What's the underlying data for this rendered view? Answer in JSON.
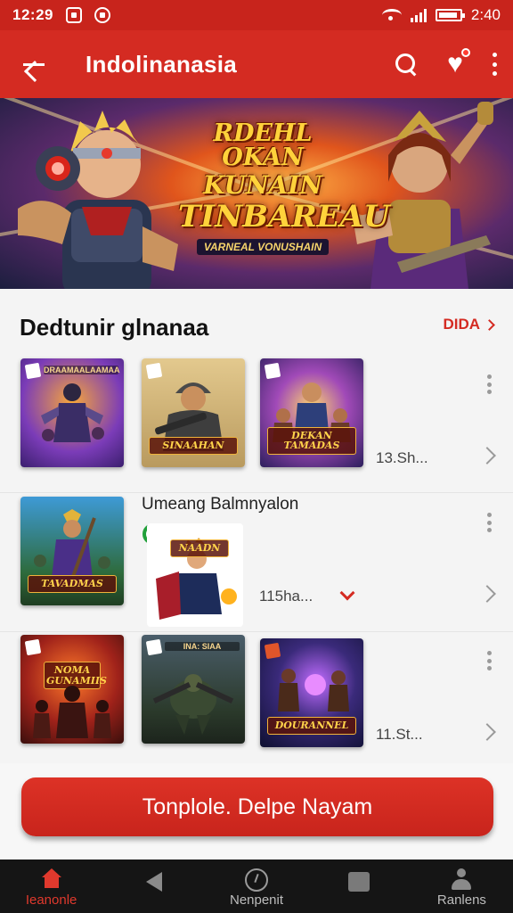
{
  "status_bar": {
    "time_left": "12:29",
    "time_right": "2:40"
  },
  "app_bar": {
    "title": "Indolinanasia",
    "icons": [
      "back-arrow-icon",
      "search-icon",
      "heart-icon",
      "more-vert-icon"
    ]
  },
  "banner": {
    "line1": "RDEHL OKAN",
    "line2": "KUNAIN",
    "line3": "TINBAREAU",
    "subtitle": "VARNEAL VONUSHAIN"
  },
  "section": {
    "title": "Dedtunir glnanaa",
    "see_all": "DIDA"
  },
  "rows": [
    {
      "count": "13.Sh...",
      "thumbs": [
        {
          "label": "",
          "top_label": "DRAAMAALAAMAA"
        },
        {
          "label": "SINAAHAN",
          "top_label": ""
        },
        {
          "label": "DEKAN TAMADAS",
          "top_label": ""
        }
      ]
    },
    {
      "title": "Umeang Balmnyalon",
      "count": "115ha...",
      "thumbs": [
        {
          "label": "TAVADMAS",
          "top_label": ""
        },
        {
          "label": "NAADN",
          "top_label": ""
        }
      ]
    },
    {
      "count": "11.St...",
      "thumbs": [
        {
          "label": "NOMA GUNAMIIS",
          "top_label": ""
        },
        {
          "label": "",
          "top_label": "INA: SIAA"
        },
        {
          "label": "DOURANNEL",
          "top_label": ""
        }
      ]
    }
  ],
  "cta": {
    "label": "Tonplole. Delpe Nayam"
  },
  "bottom_nav": {
    "items": [
      {
        "label": "Ieanonle",
        "icon": "home-icon",
        "active": true
      },
      {
        "label": "",
        "icon": "back-icon",
        "active": false
      },
      {
        "label": "Nenpenit",
        "icon": "compass-icon",
        "active": false
      },
      {
        "label": "",
        "icon": "square-icon",
        "active": false
      },
      {
        "label": "Ranlens",
        "icon": "person-icon",
        "active": false
      }
    ]
  },
  "colors": {
    "primary": "#d42b22",
    "status_bar": "#c8241c",
    "nav_bg": "#151515",
    "active": "#e0392d"
  }
}
